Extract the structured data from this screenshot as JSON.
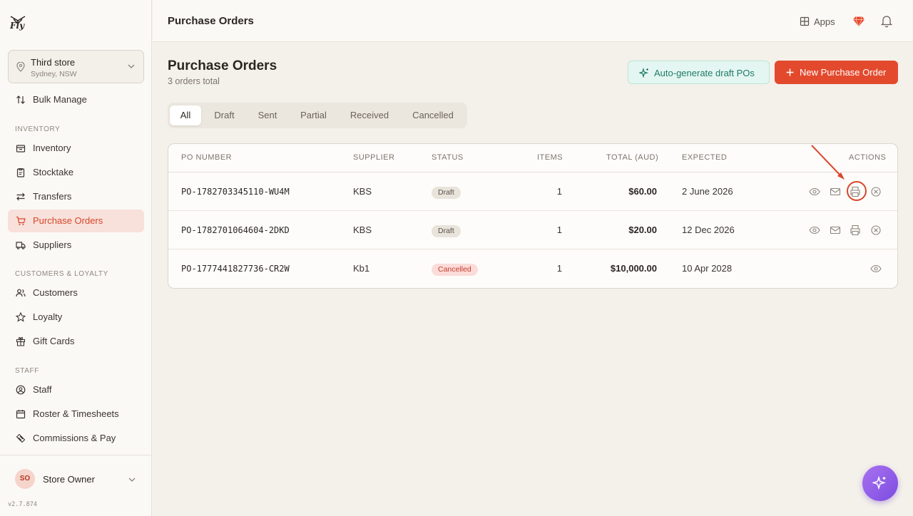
{
  "brand": {
    "logo_text": "Fly"
  },
  "store": {
    "name": "Third store",
    "location": "Sydney, NSW"
  },
  "sidebar": {
    "items": [
      {
        "label": "Bulk Manage",
        "icon": "arrows-updown-icon"
      },
      {
        "label": "Inventory",
        "icon": "box-icon"
      },
      {
        "label": "Stocktake",
        "icon": "clipboard-icon"
      },
      {
        "label": "Transfers",
        "icon": "transfer-icon"
      },
      {
        "label": "Purchase Orders",
        "icon": "cart-icon",
        "active": true
      },
      {
        "label": "Suppliers",
        "icon": "truck-icon"
      },
      {
        "label": "Customers",
        "icon": "users-icon"
      },
      {
        "label": "Loyalty",
        "icon": "star-icon"
      },
      {
        "label": "Gift Cards",
        "icon": "gift-icon"
      },
      {
        "label": "Staff",
        "icon": "user-circle-icon"
      },
      {
        "label": "Roster & Timesheets",
        "icon": "calendar-icon"
      },
      {
        "label": "Commissions & Pay",
        "icon": "coins-icon"
      }
    ],
    "sections": {
      "inventory": "INVENTORY",
      "customers": "CUSTOMERS & LOYALTY",
      "staff": "STAFF"
    }
  },
  "user": {
    "initials": "SO",
    "name": "Store Owner",
    "version": "v2.7.874"
  },
  "topbar": {
    "title": "Purchase Orders",
    "apps_label": "Apps"
  },
  "main": {
    "title": "Purchase Orders",
    "subtitle": "3 orders total",
    "auto_button": "Auto-generate draft POs",
    "new_button": "New Purchase Order",
    "tabs": [
      "All",
      "Draft",
      "Sent",
      "Partial",
      "Received",
      "Cancelled"
    ],
    "active_tab": "All"
  },
  "table": {
    "headers": {
      "po": "PO NUMBER",
      "supplier": "SUPPLIER",
      "status": "STATUS",
      "items": "ITEMS",
      "total": "TOTAL (AUD)",
      "expected": "EXPECTED",
      "actions": "ACTIONS"
    },
    "rows": [
      {
        "po": "PO-1782703345110-WU4M",
        "supplier": "KBS",
        "status": "Draft",
        "items": "1",
        "total": "$60.00",
        "expected": "2 June 2026",
        "actions": [
          "view",
          "email",
          "print",
          "cancel"
        ]
      },
      {
        "po": "PO-1782701064604-2DKD",
        "supplier": "KBS",
        "status": "Draft",
        "items": "1",
        "total": "$20.00",
        "expected": "12 Dec 2026",
        "actions": [
          "view",
          "email",
          "print",
          "cancel"
        ]
      },
      {
        "po": "PO-1777441827736-CR2W",
        "supplier": "Kb1",
        "status": "Cancelled",
        "items": "1",
        "total": "$10,000.00",
        "expected": "10 Apr 2028",
        "actions": [
          "view"
        ]
      }
    ]
  },
  "colors": {
    "accent": "#e34a2d",
    "active_bg": "#f8e1da",
    "teal": "#1f7a66",
    "fab": "#8b5cf0"
  }
}
